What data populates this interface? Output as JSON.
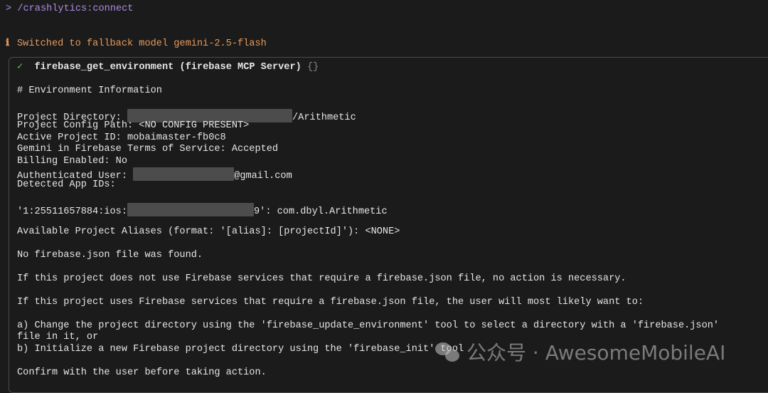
{
  "prompt": "> /crashlytics:connect",
  "info": {
    "icon": "info-icon",
    "text": "Switched to fallback model gemini-2.5-flash"
  },
  "tool": {
    "status_icon": "✓",
    "name": "firebase_get_environment (firebase MCP Server)",
    "args": "{}"
  },
  "output": {
    "heading": "# Environment Information",
    "project_dir_label": "Project Directory: ",
    "project_dir_suffix": "/Arithmetic",
    "config_path": "Project Config Path: <NO CONFIG PRESENT>",
    "active_project": "Active Project ID: mobaimaster-fb0c8",
    "tos": "Gemini in Firebase Terms of Service: Accepted",
    "billing": "Billing Enabled: No",
    "auth_label": "Authenticated User: ",
    "auth_suffix": "@gmail.com",
    "app_ids_label": "Detected App IDs:",
    "app_id_prefix": "'1:25511657884:ios:",
    "app_id_suffix": "9': com.dbyl.Arithmetic",
    "aliases": "Available Project Aliases (format: '[alias]: [projectId]'): <NONE>",
    "no_json": "No firebase.json file was found.",
    "if_not": "If this project does not use Firebase services that require a firebase.json file, no action is necessary.",
    "if_uses": "If this project uses Firebase services that require a firebase.json file, the user will most likely want to:",
    "option_a": "a) Change the project directory using the 'firebase_update_environment' tool to select a directory with a 'firebase.json'",
    "option_a2": "file in it, or",
    "option_b": "b) Initialize a new Firebase project directory using the 'firebase_init' tool",
    "confirm": "Confirm with the user before taking action."
  },
  "watermark": "公众号 · AwesomeMobileAI"
}
